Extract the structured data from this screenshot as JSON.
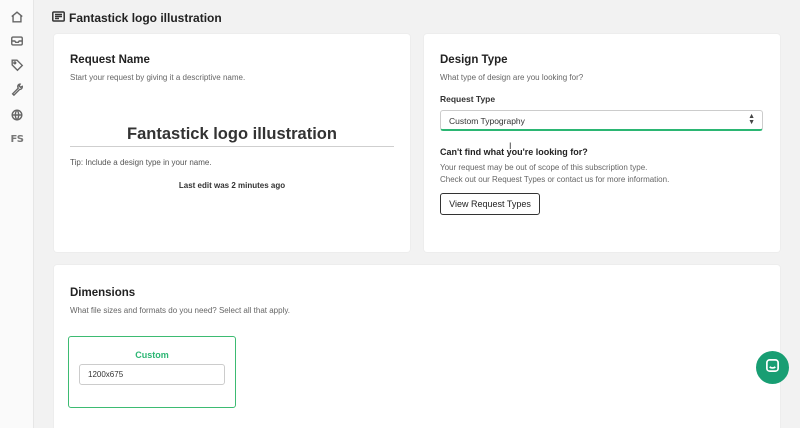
{
  "sidebar": {
    "icons": [
      "home-icon",
      "inbox-icon",
      "tag-icon",
      "wrench-icon",
      "globe-icon",
      "fs-logo"
    ],
    "logo_text": "FS"
  },
  "header": {
    "title": "Fantastick logo illustration"
  },
  "request_name_card": {
    "heading": "Request Name",
    "subtitle": "Start your request by giving it a descriptive name.",
    "name_value": "Fantastick logo illustration",
    "tip": "Tip: Include a design type in your name.",
    "last_edit": "Last edit was 2 minutes ago"
  },
  "design_type_card": {
    "heading": "Design Type",
    "subtitle": "What type of design are you looking for?",
    "request_type_label": "Request Type",
    "request_type_value": "Custom Typography",
    "cant_find": "Can't find what you're looking for?",
    "scope_line1": "Your request may be out of scope of this subscription type.",
    "scope_line2": "Check out our Request Types or contact us for more information.",
    "view_button": "View Request Types"
  },
  "dimensions_card": {
    "heading": "Dimensions",
    "subtitle": "What file sizes and formats do you need? Select all that apply.",
    "custom_label": "Custom",
    "custom_value": "1200x675"
  },
  "colors": {
    "accent": "#2bb673",
    "chat_bg": "#189e73"
  }
}
